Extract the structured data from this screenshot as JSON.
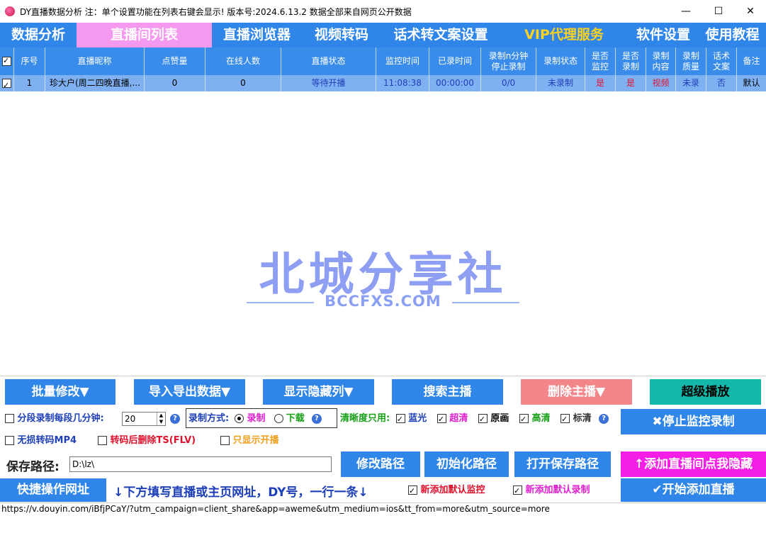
{
  "window": {
    "title": "DY直播数据分析   注：单个设置功能在列表右键会显示!    版本号:2024.6.13.2   数据全部来自网页公开数据",
    "minimize": "—",
    "maximize": "☐",
    "close": "✕"
  },
  "nav": [
    "数据分析",
    "直播间列表",
    "直播浏览器",
    "视频转码",
    "话术转文案设置",
    "VIP代理服务",
    "软件设置",
    "使用教程"
  ],
  "table": {
    "headers": [
      "序号",
      "直播昵称",
      "点赞量",
      "在线人数",
      "直播状态",
      "监控时间",
      "已录时间",
      "录制n分钟\n停止录制",
      "录制状态",
      "是否\n监控",
      "是否\n录制",
      "录制\n内容",
      "录制\n质量",
      "话术\n文案",
      "备注"
    ],
    "rows": [
      [
        "1",
        "珍大户(周二四晚直播,...",
        "0",
        "0",
        "等待开播",
        "11:08:38",
        "00:00:00",
        "0/0",
        "未录制",
        "是",
        "是",
        "视频",
        "未录",
        "否",
        "默认"
      ]
    ]
  },
  "watermark": {
    "main": "北城分享社",
    "sub": "BCCFXS.COM"
  },
  "buttons": {
    "batch_edit": "批量修改▼",
    "import_export": "导入导出数据▼",
    "show_hidden": "显示隐藏列▼",
    "search_host": "搜索主播",
    "delete_host": "删除主播▼",
    "super_play": "超级播放",
    "stop_monitor": "✖停止监控录制",
    "modify_path": "修改路径",
    "init_path": "初始化路径",
    "open_path": "打开保存路径",
    "add_hide": "↑添加直播间点我隐藏",
    "quick_url": "快捷操作网址",
    "start_add": "✔开始添加直播"
  },
  "options": {
    "segment_label": "分段录制每段几分钟:",
    "segment_value": "20",
    "record_mode_label": "录制方式:",
    "mode_record": "录制",
    "mode_download": "下载",
    "quality_label": "清晰度只用:",
    "q_bluray": "蓝光",
    "q_super": "超清",
    "q_original": "原画",
    "q_high": "高清",
    "q_standard": "标清",
    "lossless_mp4": "无损转码MP4",
    "delete_ts": "转码后删除TS(FLV)",
    "only_live": "只显示开播",
    "save_path_label": "保存路径:",
    "save_path_value": "D:\\lz\\",
    "hint": "↓下方填写直播或主页网址，DY号，一行一条↓",
    "default_monitor": "新添加默认监控",
    "default_record": "新添加默认录制",
    "help": "?"
  },
  "url_input": "https://v.douyin.com/iBfjPCaY/?utm_campaign=client_share&app=aweme&utm_medium=ios&tt_from=more&utm_source=more"
}
